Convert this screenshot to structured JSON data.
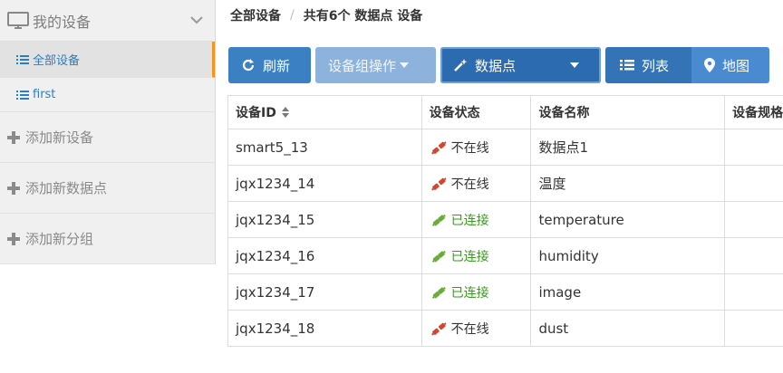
{
  "sidebar": {
    "header": "我的设备",
    "items": [
      {
        "label": "全部设备",
        "active": true
      },
      {
        "label": "first",
        "active": false
      }
    ],
    "actions": [
      {
        "label": "添加新设备"
      },
      {
        "label": "添加新数据点"
      },
      {
        "label": "添加新分组"
      }
    ]
  },
  "breadcrumb": {
    "root": "全部设备",
    "separator": "/",
    "current": "共有6个 数据点 设备"
  },
  "toolbar": {
    "refresh": "刷新",
    "group_ops": "设备组操作",
    "datapoint": "数据点",
    "list": "列表",
    "map": "地图"
  },
  "table": {
    "headers": [
      "设备ID",
      "设备状态",
      "设备名称",
      "设备规格"
    ],
    "rows": [
      {
        "id": "smart5_13",
        "status": "不在线",
        "online": false,
        "name": "数据点1"
      },
      {
        "id": "jqx1234_14",
        "status": "不在线",
        "online": false,
        "name": "温度"
      },
      {
        "id": "jqx1234_15",
        "status": "已连接",
        "online": true,
        "name": "temperature"
      },
      {
        "id": "jqx1234_16",
        "status": "已连接",
        "online": true,
        "name": "humidity"
      },
      {
        "id": "jqx1234_17",
        "status": "已连接",
        "online": true,
        "name": "image"
      },
      {
        "id": "jqx1234_18",
        "status": "不在线",
        "online": false,
        "name": "dust"
      }
    ]
  },
  "colors": {
    "accent": "#3a80c2",
    "active_marker": "#f7931e",
    "online": "#3a9a1f",
    "offline": "#d9452c"
  },
  "icons": {
    "sidebar_header": "monitor-icon",
    "list_item": "list-icon",
    "add": "plus-icon",
    "refresh": "refresh-icon",
    "datapoint": "magic-wand-icon",
    "list_view": "list-icon",
    "map_view": "map-marker-icon",
    "status": "plug-icon"
  }
}
